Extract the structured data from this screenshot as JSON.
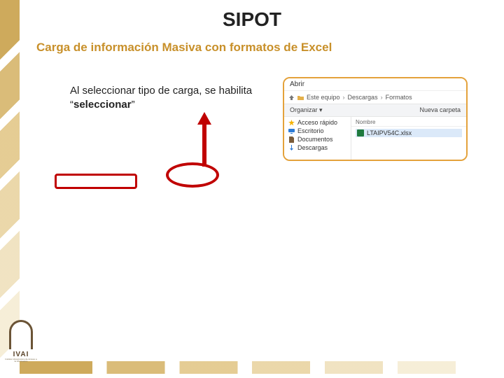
{
  "page_title": "SIPOT",
  "subtitle": "Carga de información Masiva con formatos de Excel",
  "body_text_prefix": "Al seleccionar tipo de carga, se habilita “",
  "body_text_bold": "seleccionar",
  "body_text_suffix": "”",
  "annotation": {
    "arrow_color": "#c00000",
    "rect_color": "#c00000",
    "oval_color": "#c00000"
  },
  "dialog": {
    "title": "Abrir",
    "path": [
      "Este equipo",
      "Descargas",
      "Formatos"
    ],
    "toolbar_left": "Organizar ▾",
    "toolbar_right": "Nueva carpeta",
    "sidebar": [
      {
        "icon": "star",
        "label": "Acceso rápido"
      },
      {
        "icon": "desktop",
        "label": "Escritorio"
      },
      {
        "icon": "doc",
        "label": "Documentos"
      },
      {
        "icon": "download",
        "label": "Descargas"
      }
    ],
    "column_header": "Nombre",
    "file": "LTAIPV54C.xlsx"
  },
  "logo": {
    "text": "IVAI",
    "sub": "Instituto Veracruzano de Acceso a la Información"
  }
}
